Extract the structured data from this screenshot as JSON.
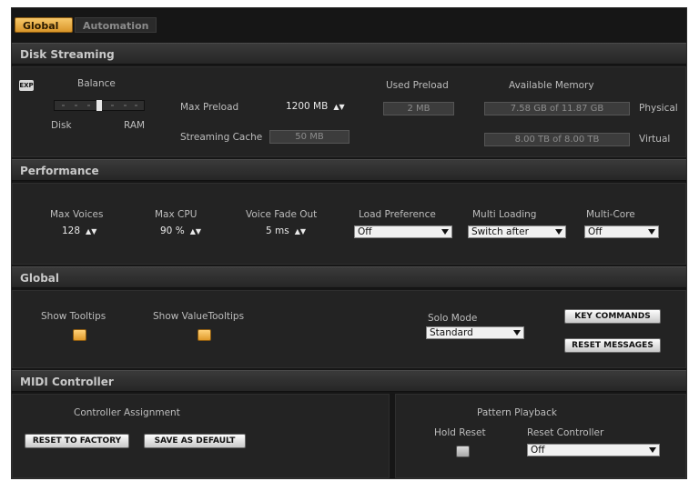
{
  "tabs": [
    {
      "label": "Global",
      "active": true
    },
    {
      "label": "Automation",
      "active": false
    }
  ],
  "disk_streaming": {
    "header": "Disk Streaming",
    "exp_label": "EXP",
    "balance_label": "Balance",
    "disk_label": "Disk",
    "ram_label": "RAM",
    "max_preload_label": "Max Preload",
    "max_preload_value": "1200 MB",
    "streaming_cache_label": "Streaming Cache",
    "streaming_cache_value": "50 MB",
    "used_preload_label": "Used Preload",
    "used_preload_value": "2 MB",
    "available_memory_label": "Available Memory",
    "physical_value": "7.58 GB of 11.87 GB",
    "physical_label": "Physical",
    "virtual_value": "8.00 TB of 8.00 TB",
    "virtual_label": "Virtual"
  },
  "performance": {
    "header": "Performance",
    "max_voices_label": "Max Voices",
    "max_voices_value": "128",
    "max_cpu_label": "Max CPU",
    "max_cpu_value": "90 %",
    "voice_fade_label": "Voice Fade Out",
    "voice_fade_value": "5 ms",
    "load_pref_label": "Load Preference",
    "load_pref_value": "Off",
    "multi_loading_label": "Multi Loading",
    "multi_loading_value": "Switch after",
    "multi_core_label": "Multi-Core",
    "multi_core_value": "Off"
  },
  "global": {
    "header": "Global",
    "show_tooltips_label": "Show Tooltips",
    "show_value_tooltips_label": "Show ValueTooltips",
    "solo_mode_label": "Solo Mode",
    "solo_mode_value": "Standard",
    "key_commands_label": "KEY COMMANDS",
    "reset_messages_label": "RESET MESSAGES"
  },
  "midi_controller": {
    "header": "MIDI Controller",
    "controller_assignment_label": "Controller Assignment",
    "reset_factory_label": "RESET TO FACTORY",
    "save_default_label": "SAVE AS DEFAULT",
    "pattern_playback_label": "Pattern Playback",
    "hold_reset_label": "Hold Reset",
    "reset_controller_label": "Reset Controller",
    "reset_controller_value": "Off"
  },
  "colors": {
    "accent": "#e8a83a",
    "background": "#161616",
    "panel": "#232323"
  }
}
